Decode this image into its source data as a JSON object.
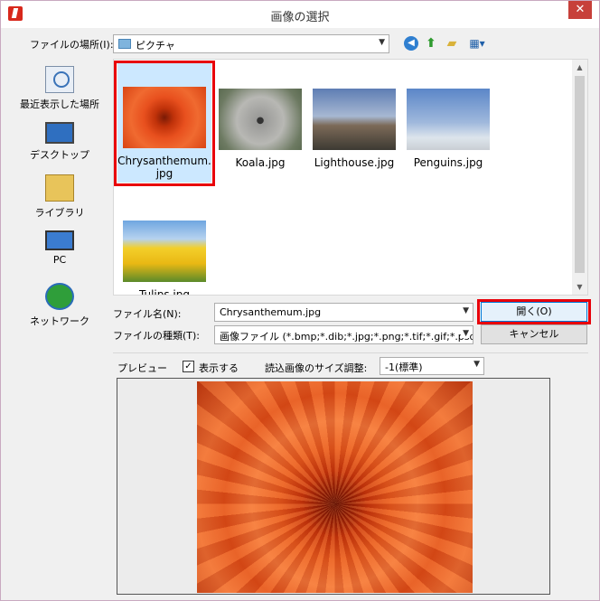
{
  "window": {
    "title": "画像の選択"
  },
  "lookin": {
    "label": "ファイルの場所(I):",
    "value": "ピクチャ"
  },
  "places": [
    {
      "label": "最近表示した場所",
      "icon": "recent-places-icon"
    },
    {
      "label": "デスクトップ",
      "icon": "desktop-icon"
    },
    {
      "label": "ライブラリ",
      "icon": "library-icon"
    },
    {
      "label": "PC",
      "icon": "pc-icon"
    },
    {
      "label": "ネットワーク",
      "icon": "network-icon"
    }
  ],
  "files": [
    {
      "line1": "Chrysanthemum.",
      "line2": "jpg",
      "selected": true
    },
    {
      "line1": "Koala.jpg",
      "line2": ""
    },
    {
      "line1": "Lighthouse.jpg",
      "line2": ""
    },
    {
      "line1": "Penguins.jpg",
      "line2": ""
    },
    {
      "line1": "Tulips.jpg",
      "line2": ""
    }
  ],
  "filename": {
    "label": "ファイル名(N):",
    "value": "Chrysanthemum.jpg"
  },
  "filetype": {
    "label": "ファイルの種類(T):",
    "value": "画像ファイル (*.bmp;*.dib;*.jpg;*.png;*.tif;*.gif;*.psd;*.fp"
  },
  "buttons": {
    "open": "開く(O)",
    "cancel": "キャンセル"
  },
  "preview": {
    "label": "プレビュー",
    "show_label": "表示する",
    "show_checked": true,
    "size_label": "読込画像のサイズ調整:",
    "size_value": "-1(標準)"
  },
  "colors": {
    "accent": "#0078d7",
    "highlight_frame": "#e8000a",
    "selection": "#cce8ff"
  }
}
